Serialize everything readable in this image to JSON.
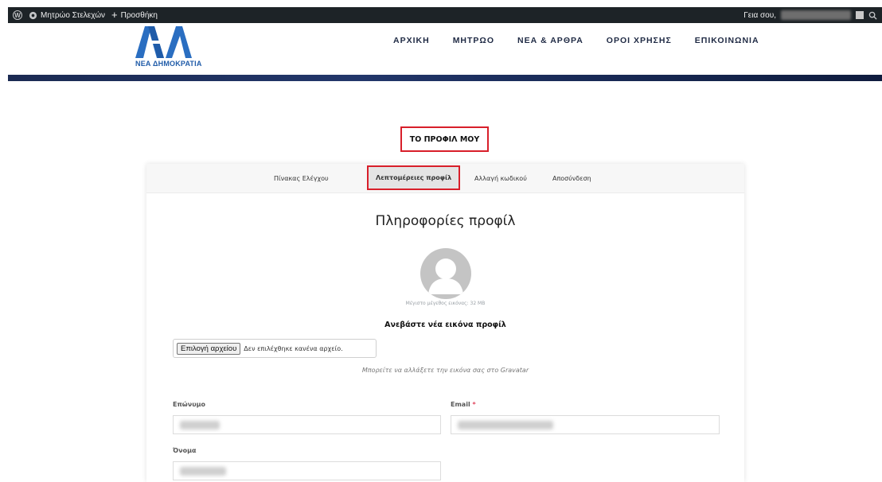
{
  "admin_bar": {
    "site_name": "Μητρώο Στελεχών",
    "add_new": "Προσθήκη",
    "greeting": "Γεια σου,"
  },
  "header": {
    "logo_text": "ΝΕΑ ΔΗΜΟΚΡΑΤΙΑ",
    "nav": [
      "ΑΡΧΙΚΗ",
      "ΜΗΤΡΩΟ",
      "ΝΕΑ & ΑΡΘΡΑ",
      "ΟΡΟΙ ΧΡΗΣΗΣ",
      "ΕΠΙΚΟΙΝΩΝΙΑ"
    ]
  },
  "page": {
    "title": "ΤΟ ΠΡΟΦΙΛ ΜΟΥ"
  },
  "tabs": [
    "Πίνακας Ελέγχου",
    "Λεπτομέρειες προφίλ",
    "Αλλαγή κωδικού",
    "Αποσύνδεση"
  ],
  "active_tab": "Λεπτομέρειες προφίλ",
  "profile": {
    "section_title": "Πληροφορίες προφίλ",
    "max_size": "Μέγιστο μέγεθος εικόνας: 32 MB",
    "upload_title": "Ανεβάστε νέα εικόνα προφίλ",
    "file_button": "Επιλογή αρχείου",
    "file_status": "Δεν επιλέχθηκε κανένα αρχείο.",
    "gravatar_note": "Μπορείτε να αλλάξετε την εικόνα σας στο Gravatar"
  },
  "form": {
    "surname_label": "Επώνυμο",
    "email_label": "Email",
    "required_mark": "*",
    "name_label": "Όνομα"
  },
  "colors": {
    "admin_bar": "#1d2327",
    "brand_blue": "#1f5ba8",
    "highlight_red": "#d81f2a"
  }
}
